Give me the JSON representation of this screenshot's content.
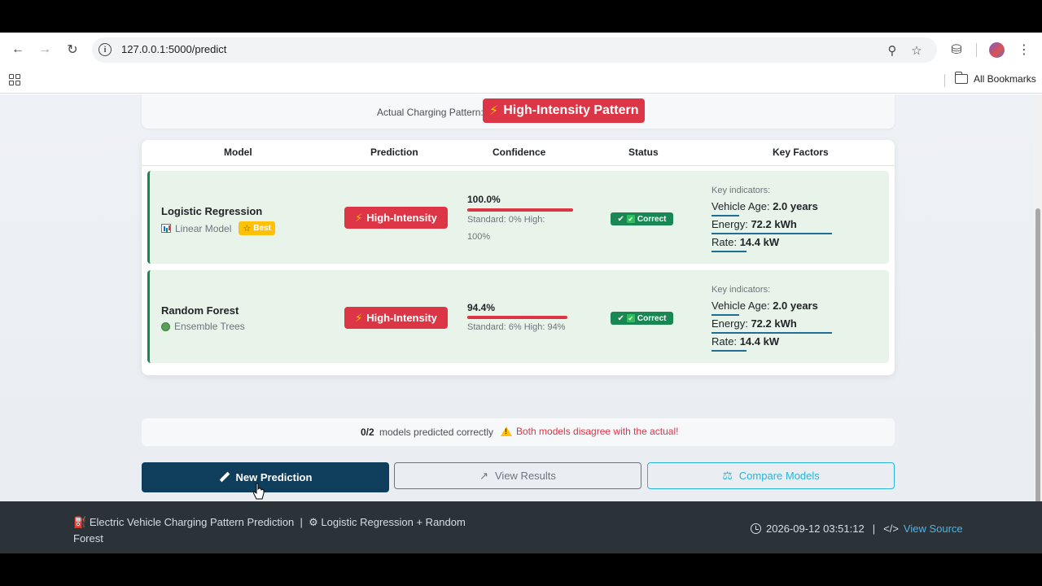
{
  "browser": {
    "url": "127.0.0.1:5000/predict",
    "bookmarks_label": "All Bookmarks"
  },
  "actual": {
    "label": "Actual Charging Pattern:",
    "value": "High-Intensity Pattern"
  },
  "table": {
    "headers": [
      "Model",
      "Prediction",
      "Confidence",
      "Status",
      "Key Factors"
    ],
    "rows": [
      {
        "model": "Logistic Regression",
        "type": "Linear Model",
        "badge": "Best",
        "prediction": "High-Intensity",
        "confidence": "100.0%",
        "confidence_value": 100.0,
        "confidence_detail": "Standard: 0% High: 100%",
        "status": "Correct",
        "key_title": "Key indicators:",
        "factors": [
          {
            "label": "Vehicle Age:",
            "value": "2.0 years"
          },
          {
            "label": "Energy:",
            "value": "72.2 kWh"
          },
          {
            "label": "Rate:",
            "value": "14.4 kW"
          }
        ]
      },
      {
        "model": "Random Forest",
        "type": "Ensemble Trees",
        "prediction": "High-Intensity",
        "confidence": "94.4%",
        "confidence_value": 94.4,
        "confidence_detail": "Standard: 6% High: 94%",
        "status": "Correct",
        "key_title": "Key indicators:",
        "factors": [
          {
            "label": "Vehicle Age:",
            "value": "2.0 years"
          },
          {
            "label": "Energy:",
            "value": "72.2 kWh"
          },
          {
            "label": "Rate:",
            "value": "14.4 kW"
          }
        ]
      }
    ]
  },
  "summary": {
    "count": "0/2",
    "text": "models predicted correctly",
    "warning": "Both models disagree with the actual!"
  },
  "buttons": {
    "new_prediction": "New Prediction",
    "view_results": "View Results",
    "compare_models": "Compare Models"
  },
  "footer": {
    "project": "Electric Vehicle Charging Pattern Prediction",
    "separator": "|",
    "models": "Logistic Regression + Random Forest",
    "timestamp": "2026-09-12 03:51:12",
    "source_link": "View Source"
  },
  "colors": {
    "danger": "#dc3545",
    "success": "#198754",
    "primary_dark": "#0f3d5c",
    "info": "#28b5d8",
    "warning": "#ffc107"
  }
}
